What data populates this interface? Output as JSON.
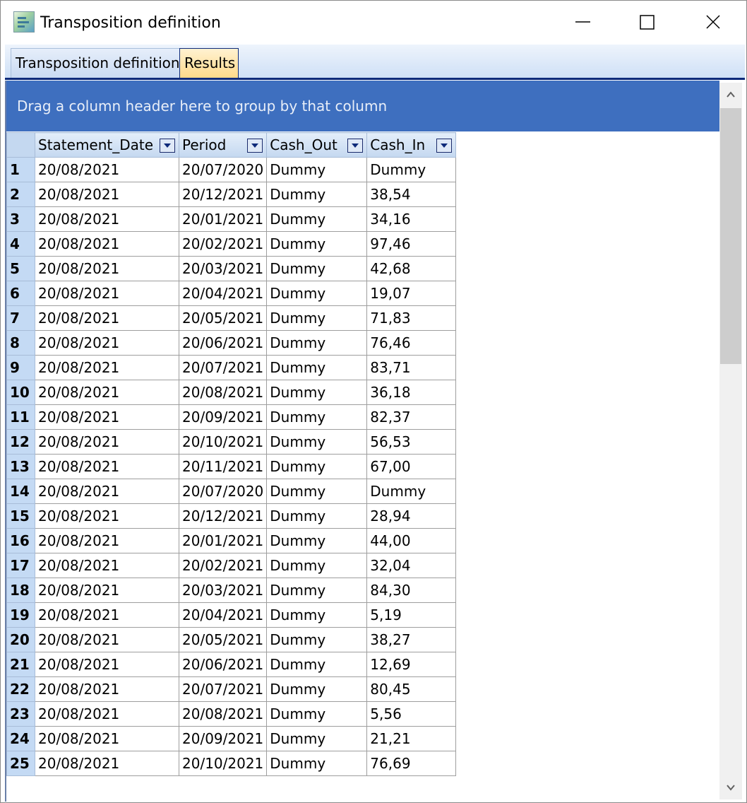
{
  "window": {
    "title": "Transposition definition",
    "icon": "app-icon"
  },
  "tabs": [
    {
      "label": "Transposition definition",
      "active": false
    },
    {
      "label": "Results",
      "active": true
    }
  ],
  "grid": {
    "group_panel_text": "Drag a column header here to group by that column",
    "columns": [
      "Statement_Date",
      "Period",
      "Cash_Out",
      "Cash_In"
    ],
    "rows": [
      [
        "1",
        "20/08/2021",
        "20/07/2020",
        "Dummy",
        "Dummy"
      ],
      [
        "2",
        "20/08/2021",
        "20/12/2021",
        "Dummy",
        "38,54"
      ],
      [
        "3",
        "20/08/2021",
        "20/01/2021",
        "Dummy",
        "34,16"
      ],
      [
        "4",
        "20/08/2021",
        "20/02/2021",
        "Dummy",
        "97,46"
      ],
      [
        "5",
        "20/08/2021",
        "20/03/2021",
        "Dummy",
        "42,68"
      ],
      [
        "6",
        "20/08/2021",
        "20/04/2021",
        "Dummy",
        "19,07"
      ],
      [
        "7",
        "20/08/2021",
        "20/05/2021",
        "Dummy",
        "71,83"
      ],
      [
        "8",
        "20/08/2021",
        "20/06/2021",
        "Dummy",
        "76,46"
      ],
      [
        "9",
        "20/08/2021",
        "20/07/2021",
        "Dummy",
        "83,71"
      ],
      [
        "10",
        "20/08/2021",
        "20/08/2021",
        "Dummy",
        "36,18"
      ],
      [
        "11",
        "20/08/2021",
        "20/09/2021",
        "Dummy",
        "82,37"
      ],
      [
        "12",
        "20/08/2021",
        "20/10/2021",
        "Dummy",
        "56,53"
      ],
      [
        "13",
        "20/08/2021",
        "20/11/2021",
        "Dummy",
        "67,00"
      ],
      [
        "14",
        "20/08/2021",
        "20/07/2020",
        "Dummy",
        "Dummy"
      ],
      [
        "15",
        "20/08/2021",
        "20/12/2021",
        "Dummy",
        "28,94"
      ],
      [
        "16",
        "20/08/2021",
        "20/01/2021",
        "Dummy",
        "44,00"
      ],
      [
        "17",
        "20/08/2021",
        "20/02/2021",
        "Dummy",
        "32,04"
      ],
      [
        "18",
        "20/08/2021",
        "20/03/2021",
        "Dummy",
        "84,30"
      ],
      [
        "19",
        "20/08/2021",
        "20/04/2021",
        "Dummy",
        "5,19"
      ],
      [
        "20",
        "20/08/2021",
        "20/05/2021",
        "Dummy",
        "38,27"
      ],
      [
        "21",
        "20/08/2021",
        "20/06/2021",
        "Dummy",
        "12,69"
      ],
      [
        "22",
        "20/08/2021",
        "20/07/2021",
        "Dummy",
        "80,45"
      ],
      [
        "23",
        "20/08/2021",
        "20/08/2021",
        "Dummy",
        "5,56"
      ],
      [
        "24",
        "20/08/2021",
        "20/09/2021",
        "Dummy",
        "21,21"
      ],
      [
        "25",
        "20/08/2021",
        "20/10/2021",
        "Dummy",
        "76,69"
      ]
    ]
  },
  "colors": {
    "group_panel_bg": "#3e6fbf",
    "row_header_bg": "#c4daf4",
    "active_tab_bg": "#ffd98a"
  }
}
